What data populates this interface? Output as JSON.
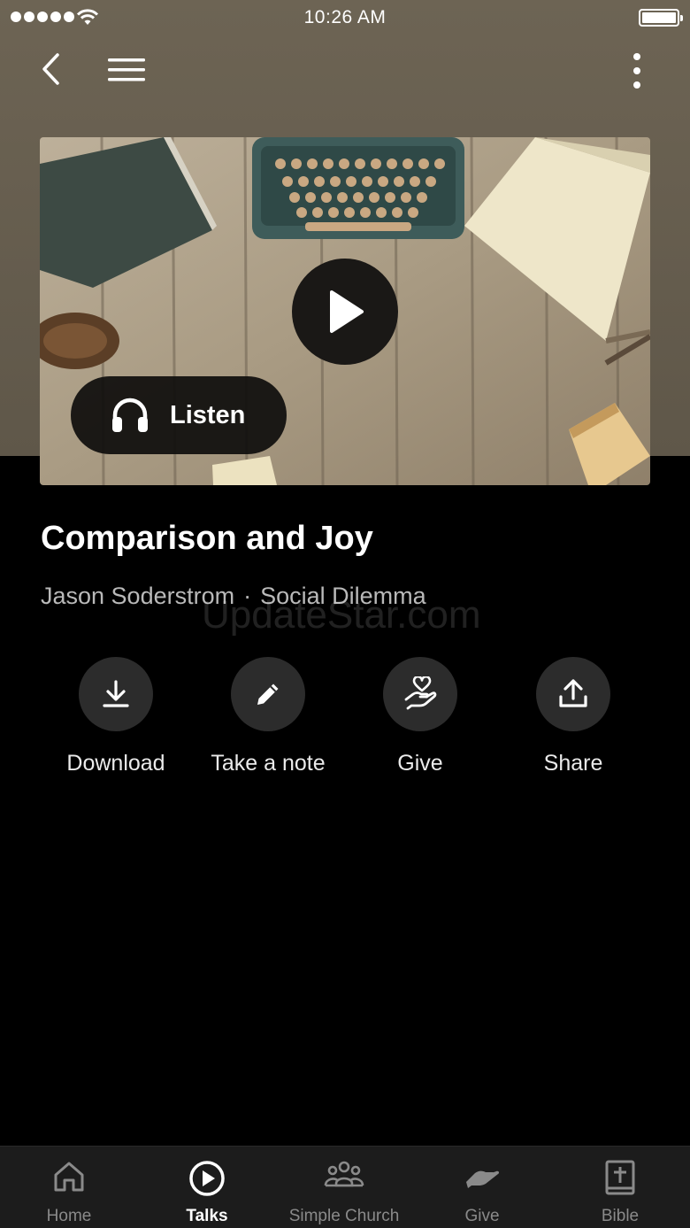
{
  "status_bar": {
    "time": "10:26 AM"
  },
  "hero": {
    "listen_label": "Listen"
  },
  "talk": {
    "title": "Comparison and Joy",
    "speaker": "Jason Soderstrom",
    "separator": "·",
    "series": "Social Dilemma"
  },
  "watermark": "UpdateStar.com",
  "actions": [
    {
      "label": "Download",
      "icon": "download-icon"
    },
    {
      "label": "Take a note",
      "icon": "pencil-icon"
    },
    {
      "label": "Give",
      "icon": "give-heart-hand-icon"
    },
    {
      "label": "Share",
      "icon": "share-icon"
    }
  ],
  "tabs": [
    {
      "label": "Home",
      "icon": "home-icon",
      "active": false
    },
    {
      "label": "Talks",
      "icon": "play-circle-icon",
      "active": true
    },
    {
      "label": "Simple Church",
      "icon": "group-icon",
      "active": false
    },
    {
      "label": "Give",
      "icon": "give-hand-icon",
      "active": false
    },
    {
      "label": "Bible",
      "icon": "bible-icon",
      "active": false
    }
  ],
  "colors": {
    "header_background": "#6d6454",
    "page_background": "#000000",
    "action_circle": "#2c2c2c",
    "tabbar_background": "#1c1c1c",
    "tab_inactive": "#8a8a8a",
    "tab_active": "#ffffff"
  }
}
